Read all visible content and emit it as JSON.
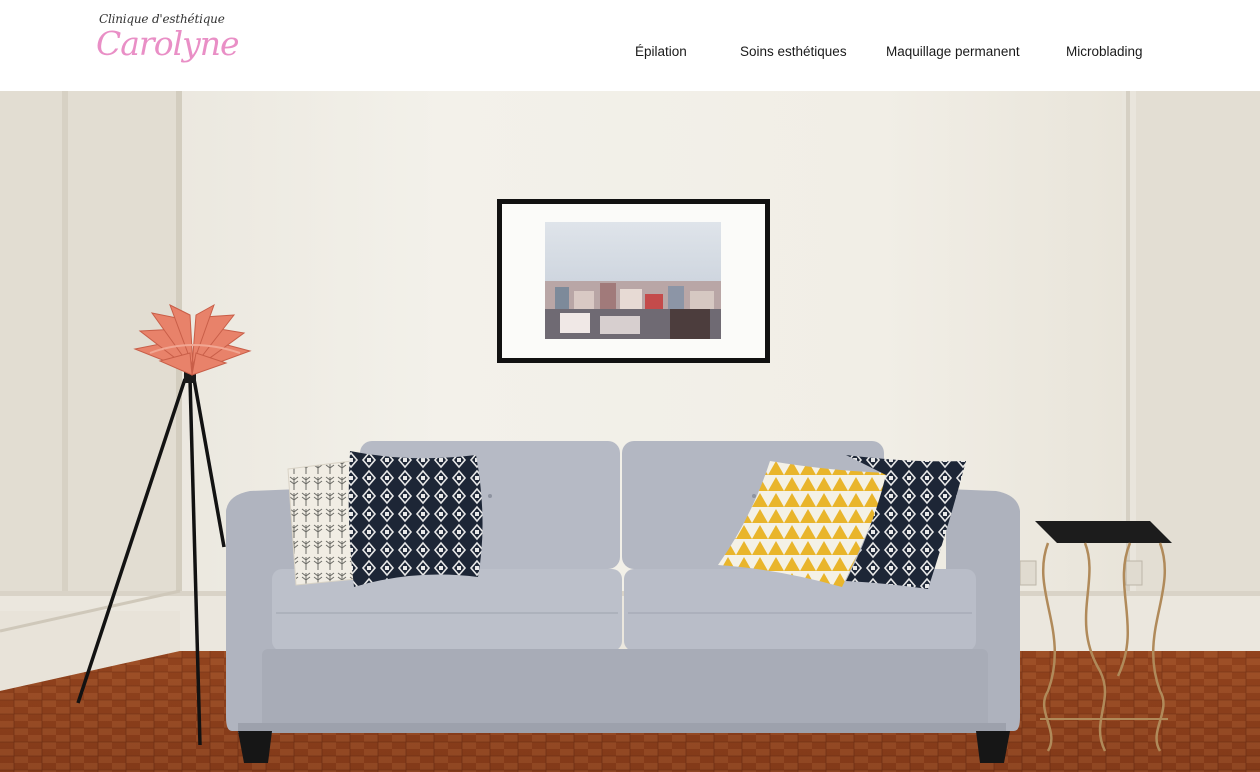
{
  "logo": {
    "top_line": "Clinique d'esthétique",
    "name": "Carolyne",
    "accent_color": "#e98fc6"
  },
  "nav": {
    "items": [
      {
        "label": "Épilation"
      },
      {
        "label": "Soins esthétiques"
      },
      {
        "label": "Maquillage permanent"
      },
      {
        "label": "Microblading"
      }
    ]
  },
  "hero": {
    "image": "living room with grey sofa, patterned cushions, framed cityscape print, copper lotus floor lamp and side table"
  }
}
